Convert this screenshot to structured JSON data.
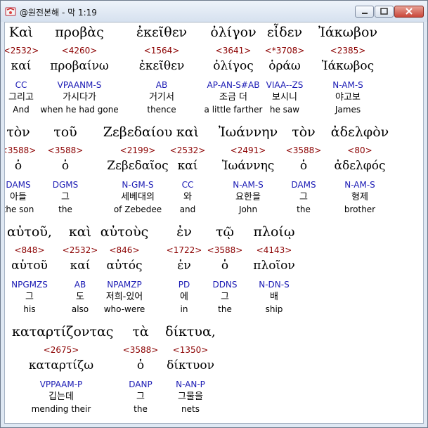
{
  "window": {
    "title": "@원전본해 - 막 1:19",
    "app_icon": "bible-app-icon",
    "controls": [
      "minimize",
      "maximize",
      "close"
    ]
  },
  "lines": [
    [
      {
        "greek": "Καὶ",
        "num": "<2532>",
        "lemma": "καί",
        "parse": "CC",
        "kor": "그리고",
        "eng": "And"
      },
      {
        "greek": "προβὰς",
        "num": "<4260>",
        "lemma": "προβαίνω",
        "parse": "VPAANM-S",
        "kor": "가시다가",
        "eng": "when he had gone"
      },
      {
        "greek": "ἐκεῖθεν",
        "num": "<1564>",
        "lemma": "ἐκεῖθεν",
        "parse": "AB",
        "kor": "거기서",
        "eng": "thence"
      },
      {
        "greek": "ὀλίγον",
        "num": "<3641>",
        "lemma": "ὀλίγος",
        "parse": "AP-AN-S#AB",
        "kor": "조금 더",
        "eng": "a little farther"
      },
      {
        "greek": "εἶδεν",
        "num": "<*3708>",
        "lemma": "ὁράω",
        "parse": "VIAA--ZS",
        "kor": "보시니",
        "eng": "he saw"
      },
      {
        "greek": "Ἰάκωβον",
        "num": "<2385>",
        "lemma": "Ἰάκωβος",
        "parse": "N-AM-S",
        "kor": "야고보",
        "eng": "James"
      }
    ],
    [
      {
        "greek": "τὸν",
        "num": "<3588>",
        "lemma": "ὁ",
        "parse": "DAMS",
        "kor": "아들",
        "eng": "the son"
      },
      {
        "greek": "τοῦ",
        "num": "<3588>",
        "lemma": "ὁ",
        "parse": "DGMS",
        "kor": "그",
        "eng": "the"
      },
      {
        "greek": "Ζεβεδαίου",
        "num": "<2199>",
        "lemma": "Ζεβεδαῖος",
        "parse": "N-GM-S",
        "kor": "세베대의",
        "eng": "of Zebedee"
      },
      {
        "greek": "καὶ",
        "num": "<2532>",
        "lemma": "καί",
        "parse": "CC",
        "kor": "와",
        "eng": "and"
      },
      {
        "greek": "Ἰωάννην",
        "num": "<2491>",
        "lemma": "Ἰωάννης",
        "parse": "N-AM-S",
        "kor": "요한을",
        "eng": "John"
      },
      {
        "greek": "τὸν",
        "num": "<3588>",
        "lemma": "ὁ",
        "parse": "DAMS",
        "kor": "그",
        "eng": "the"
      },
      {
        "greek": "ἀδελφὸν",
        "num": "<80>",
        "lemma": "ἀδελφός",
        "parse": "N-AM-S",
        "kor": "형제",
        "eng": "brother"
      }
    ],
    [
      {
        "greek": "αὐτοῦ,",
        "num": "<848>",
        "lemma": "αὑτοῦ",
        "parse": "NPGMZS",
        "kor": "그",
        "eng": "his"
      },
      {
        "greek": "καὶ",
        "num": "<2532>",
        "lemma": "καί",
        "parse": "AB",
        "kor": "도",
        "eng": "also"
      },
      {
        "greek": "αὐτοὺς",
        "num": "<846>",
        "lemma": "αὐτός",
        "parse": "NPAMZP",
        "kor": "저희-있어",
        "eng": "who-were"
      },
      {
        "greek": "ἐν",
        "num": "<1722>",
        "lemma": "ἐν",
        "parse": "PD",
        "kor": "에",
        "eng": "in"
      },
      {
        "greek": "τῷ",
        "num": "<3588>",
        "lemma": "ὁ",
        "parse": "DDNS",
        "kor": "그",
        "eng": "the"
      },
      {
        "greek": "πλοίῳ",
        "num": "<4143>",
        "lemma": "πλοῖον",
        "parse": "N-DN-S",
        "kor": "배",
        "eng": "ship"
      }
    ],
    [
      {
        "greek": "καταρτίζοντας",
        "num": "<2675>",
        "lemma": "καταρτίζω",
        "parse": "VPPAAM-P",
        "kor": "깁는데",
        "eng": "mending their"
      },
      {
        "greek": "τὰ",
        "num": "<3588>",
        "lemma": "ὁ",
        "parse": "DANP",
        "kor": "그",
        "eng": "the"
      },
      {
        "greek": "δίκτυα,",
        "num": "<1350>",
        "lemma": "δίκτυον",
        "parse": "N-AN-P",
        "kor": "그물을",
        "eng": "nets"
      }
    ]
  ]
}
